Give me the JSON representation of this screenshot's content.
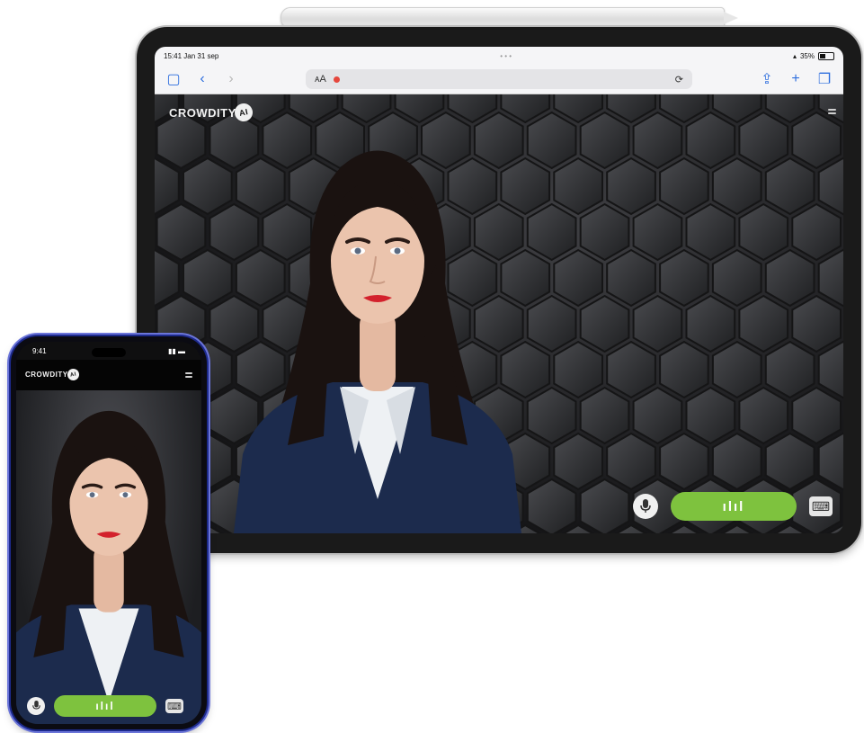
{
  "tablet": {
    "status_bar": {
      "time": "15:41  Jan 31 sep",
      "battery": "35%"
    },
    "toolbar": {
      "sidebar_icon": "▢",
      "back_icon": "‹",
      "forward_icon": "›",
      "reader_icon": "ᴀA",
      "reload_icon": "⟳",
      "share_icon": "⇪",
      "new_tab_icon": "+",
      "tabs_icon": "❐"
    },
    "logo_text": "CROWDITY",
    "logo_badge": "AI",
    "talk_label": "ılıl",
    "keyboard_icon": "⌨"
  },
  "phone": {
    "status_bar": {
      "time": "9:41"
    },
    "logo_text": "CROWDITY",
    "logo_badge": "AI",
    "talk_label": "ılıl",
    "keyboard_icon": "⌨"
  },
  "colors": {
    "accent_green": "#7ec23e",
    "browser_blue": "#2f6fde",
    "blazer_navy": "#1c2b4d",
    "lipstick_red": "#d3212c"
  }
}
